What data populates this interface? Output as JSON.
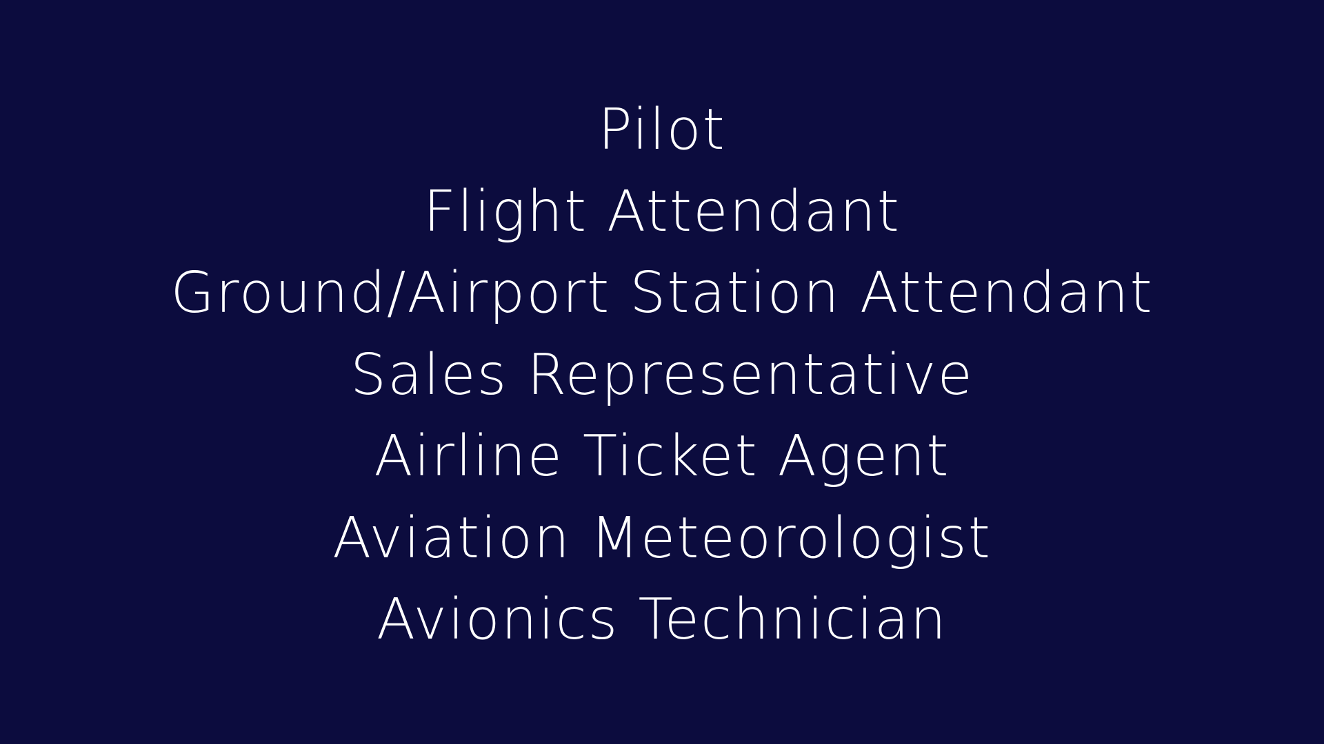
{
  "colors": {
    "background": "#0c0c3e",
    "text": "#ffffff"
  },
  "jobs": [
    "Pilot",
    "Flight Attendant",
    "Ground/Airport Station Attendant",
    "Sales Representative",
    "Airline Ticket Agent",
    "Aviation Meteorologist",
    "Avionics Technician"
  ]
}
